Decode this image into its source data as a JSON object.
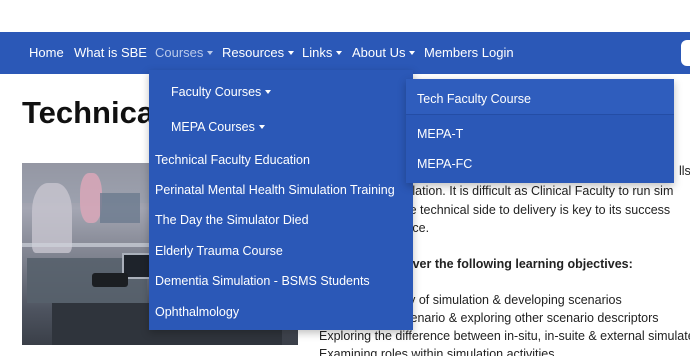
{
  "nav": {
    "items": [
      {
        "label": "Home"
      },
      {
        "label": "What is SBE"
      },
      {
        "label": "Courses"
      },
      {
        "label": "Resources"
      },
      {
        "label": "Links"
      },
      {
        "label": "About Us"
      },
      {
        "label": "Members Login"
      }
    ]
  },
  "page": {
    "title": "Technical Faculty Education"
  },
  "courses_menu": {
    "items": [
      {
        "label": "Faculty Courses"
      },
      {
        "label": "MEPA Courses"
      },
      {
        "label": "Technical Faculty Education"
      },
      {
        "label": "Perinatal Mental Health Simulation Training"
      },
      {
        "label": "The Day the Simulator Died"
      },
      {
        "label": "Elderly Trauma Course"
      },
      {
        "label": "Dementia Simulation - BSMS Students"
      },
      {
        "label": "Ophthalmology"
      }
    ]
  },
  "sub_menu": {
    "items": [
      {
        "label": "Tech Faculty Course"
      },
      {
        "label": "MEPA-T"
      },
      {
        "label": "MEPA-FC"
      }
    ]
  },
  "body": {
    "lines": [
      "lls",
      "simulation.  It is difficult as Clinical Faculty to run sim",
      "in the technical side to delivery is key to its success",
      "s place.",
      "cover the following learning objectives:",
      "ery of simulation & developing scenarios",
      "scenario & exploring other scenario descriptors",
      "Exploring the difference between in-situ, in-suite & external simulated",
      "Examining roles within simulation activities"
    ]
  },
  "colors": {
    "nav_bg": "#2b58b7",
    "menu_bg": "#2b58b7",
    "text_white": "#ffffff",
    "active_nav": "#b9c9ea"
  }
}
